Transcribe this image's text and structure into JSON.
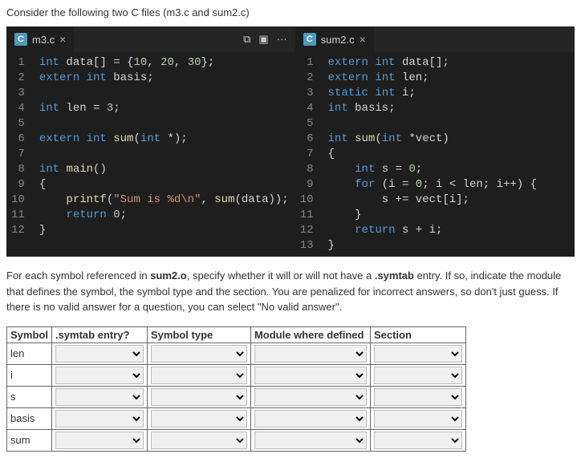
{
  "question_intro": "Consider the following two C files (m3.c and sum2.c)",
  "tabs": {
    "left": "m3.c",
    "right": "sum2.c"
  },
  "icons": {
    "close": "×",
    "more": "···",
    "compare": "⧉",
    "split": "▣"
  },
  "code_left": {
    "lines": [
      "1",
      "2",
      "3",
      "4",
      "5",
      "6",
      "7",
      "8",
      "9",
      "10",
      "11",
      "12"
    ],
    "l1_a": "int",
    "l1_b": " data[] = {",
    "l1_c": "10",
    "l1_d": ", ",
    "l1_e": "20",
    "l1_f": ", ",
    "l1_g": "30",
    "l1_h": "};",
    "l2_a": "extern int",
    "l2_b": " basis;",
    "l3": "",
    "l4_a": "int",
    "l4_b": " len = ",
    "l4_c": "3",
    "l4_d": ";",
    "l5": "",
    "l6_a": "extern int",
    "l6_b": " ",
    "l6_c": "sum",
    "l6_d": "(",
    "l6_e": "int",
    "l6_f": " *);",
    "l7": "",
    "l8_a": "int",
    "l8_b": " ",
    "l8_c": "main",
    "l8_d": "()",
    "l9": "{",
    "l10_a": "    ",
    "l10_b": "printf",
    "l10_c": "(",
    "l10_d": "\"Sum is %d\\n\"",
    "l10_e": ", ",
    "l10_f": "sum",
    "l10_g": "(data));",
    "l11_a": "    ",
    "l11_b": "return",
    "l11_c": " ",
    "l11_d": "0",
    "l11_e": ";",
    "l12": "}"
  },
  "code_right": {
    "lines": [
      "1",
      "2",
      "3",
      "4",
      "5",
      "6",
      "7",
      "8",
      "9",
      "10",
      "11",
      "12",
      "13"
    ],
    "l1_a": "extern int",
    "l1_b": " data[];",
    "l2_a": "extern int",
    "l2_b": " len;",
    "l3_a": "static int",
    "l3_b": " i;",
    "l4_a": "int",
    "l4_b": " basis;",
    "l5": "",
    "l6_a": "int",
    "l6_b": " ",
    "l6_c": "sum",
    "l6_d": "(",
    "l6_e": "int",
    "l6_f": " *vect)",
    "l7": "{",
    "l8_a": "    ",
    "l8_b": "int",
    "l8_c": " s = ",
    "l8_d": "0",
    "l8_e": ";",
    "l9_a": "    ",
    "l9_b": "for",
    "l9_c": " (i = ",
    "l9_d": "0",
    "l9_e": "; i < len; i++) {",
    "l10": "        s += vect[i];",
    "l11": "    }",
    "l12_a": "    ",
    "l12_b": "return",
    "l12_c": " s + i;",
    "l13": "}"
  },
  "instructions_a": "For each symbol referenced in ",
  "instructions_b": "sum2.o",
  "instructions_c": ", specify whether it will or will not have a ",
  "instructions_d": ".symtab",
  "instructions_e": " entry. If so, indicate the module that defines the symbol, the symbol type and the section. You are penalized for incorrect answers, so don't just guess. If there is no valid answer for a question, you can select \"No valid answer\".",
  "table": {
    "headers": [
      "Symbol",
      ".symtab entry?",
      "Symbol type",
      "Module where defined",
      "Section"
    ],
    "symbols": [
      "len",
      "i",
      "s",
      "basis",
      "sum"
    ]
  }
}
